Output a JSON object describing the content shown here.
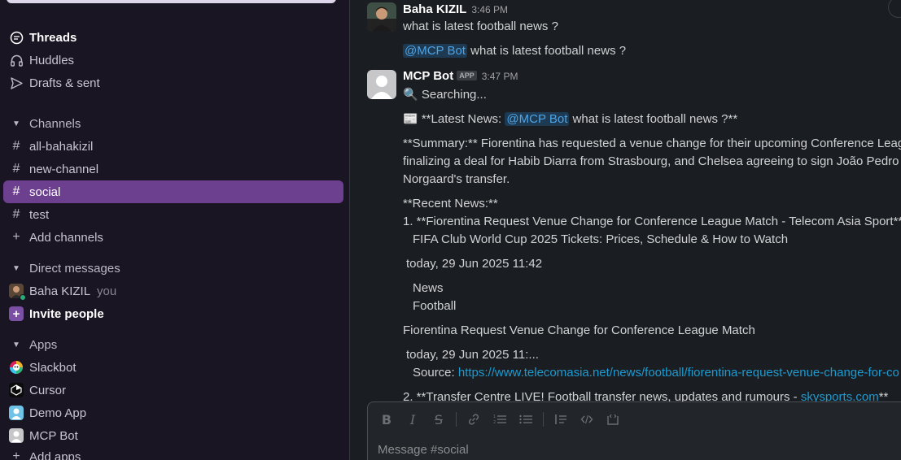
{
  "sidebar": {
    "nav": [
      {
        "label": "Threads",
        "icon": "threads-icon"
      },
      {
        "label": "Huddles",
        "icon": "headphones-icon"
      },
      {
        "label": "Drafts & sent",
        "icon": "send-icon"
      }
    ],
    "channels_header": "Channels",
    "channels": [
      "all-bahakizil",
      "new-channel",
      "social",
      "test"
    ],
    "active_channel": "social",
    "add_channels": "Add channels",
    "dm_header": "Direct messages",
    "dm_user": "Baha KIZIL",
    "dm_you": "you",
    "invite": "Invite people",
    "apps_header": "Apps",
    "apps": [
      "Slackbot",
      "Cursor",
      "Demo App",
      "MCP Bot"
    ],
    "add_apps": "Add apps"
  },
  "messages": {
    "m1": {
      "name": "Baha KIZIL",
      "time": "3:46 PM",
      "text1": "what is latest football news ?",
      "mention": "@MCP Bot",
      "text2": " what is latest football news ?"
    },
    "m2": {
      "name": "MCP Bot",
      "badge": "APP",
      "time": "3:47 PM",
      "searching": "🔍 Searching...",
      "latest_prefix": "📰 **Latest News: ",
      "latest_mention": "@MCP Bot",
      "latest_suffix": " what is latest football news ?**",
      "summary1": "**Summary:** Fiorentina has requested a venue change for their upcoming Conference League",
      "summary2": "finalizing a deal for Habib Diarra from Strasbourg, and Chelsea agreeing to sign João Pedro fro",
      "summary3": "Norgaard's transfer.",
      "recent_header": "**Recent News:**",
      "item1": "1. **Fiorentina Request Venue Change for Conference League Match - Telecom Asia Sport**",
      "item1_sub": "FIFA Club World Cup 2025 Tickets: Prices, Schedule & How to Watch",
      "date1": "today, 29 Jun 2025 11:42",
      "tag1": "News",
      "tag2": "Football",
      "headline2": "Fiorentina Request Venue Change for Conference League Match",
      "date2": "today, 29 Jun 2025 11:...",
      "source_label": "Source: ",
      "source_url": "https://www.telecomasia.net/news/football/fiorentina-request-venue-change-for-co",
      "item2_prefix": "2. **Transfer Centre LIVE! Football transfer news, updates and rumours - ",
      "item2_link": "skysports.com",
      "item2_suffix": "**"
    }
  },
  "composer": {
    "placeholder": "Message #social"
  },
  "colors": {
    "sidebar_bg": "#1a1522",
    "active": "#6c3f8f",
    "link": "#1d9bd1",
    "main_bg": "#1a1d21"
  }
}
